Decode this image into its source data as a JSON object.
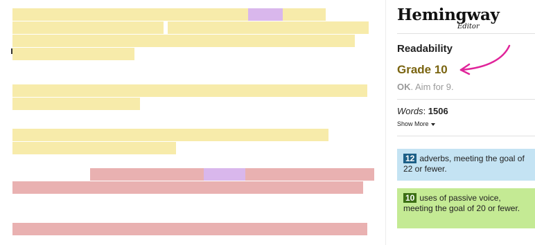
{
  "app": {
    "logo_title": "Hemingway",
    "logo_subtitle": "Editor"
  },
  "readability": {
    "label": "Readability",
    "grade": "Grade 10",
    "status": "OK",
    "aim": ". Aim for 9."
  },
  "stats": {
    "words_label": "Words",
    "words_value": "1506",
    "show_more": "Show More"
  },
  "cards": {
    "adverbs": {
      "count": "12",
      "text": "adverbs, meeting the goal of 22 or fewer."
    },
    "passive": {
      "count": "10",
      "text": "uses of passive voice, meeting the goal of 20 or fewer."
    }
  },
  "colors": {
    "hard_sentence": "#f7ebaa",
    "very_hard_sentence": "#e9b1b1",
    "complex_phrase": "#d9b7ec",
    "adverb_card": "#c4e3f3",
    "passive_card": "#c4ea94",
    "grade_text": "#7a6410",
    "annotation_arrow": "#e0249a"
  }
}
